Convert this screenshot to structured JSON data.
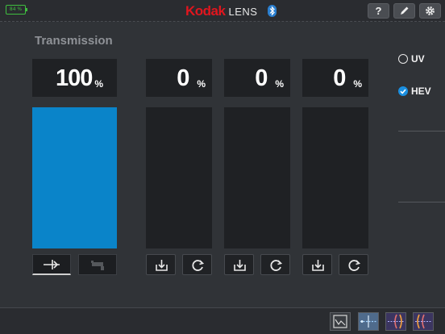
{
  "header": {
    "battery": "84 %",
    "brand": "Kodak",
    "product": "LENS",
    "bluetooth_glyph": "ʙ",
    "help_label": "?",
    "edit_icon": "pencil-icon",
    "settings_icon": "gear-icon"
  },
  "page_title": "Transmission",
  "readouts": [
    {
      "value": "100",
      "unit": "%",
      "level": 1.0
    },
    {
      "value": "0",
      "unit": "%",
      "level": 0.0
    },
    {
      "value": "0",
      "unit": "%",
      "level": 0.0
    },
    {
      "value": "0",
      "unit": "%",
      "level": 0.0
    }
  ],
  "options": {
    "uv_label": "UV",
    "uv_selected": false,
    "hev_label": "HEV",
    "hev_selected": true
  },
  "colors": {
    "accent": "#0a84c9",
    "brand_red": "#e0161e",
    "battery_green": "#3fbf3f",
    "check_blue": "#1a8fe0"
  },
  "bottom_icons": [
    "chart-view-icon",
    "light-path-icon",
    "lens-compare-icon",
    "lens-compare-alt-icon"
  ]
}
